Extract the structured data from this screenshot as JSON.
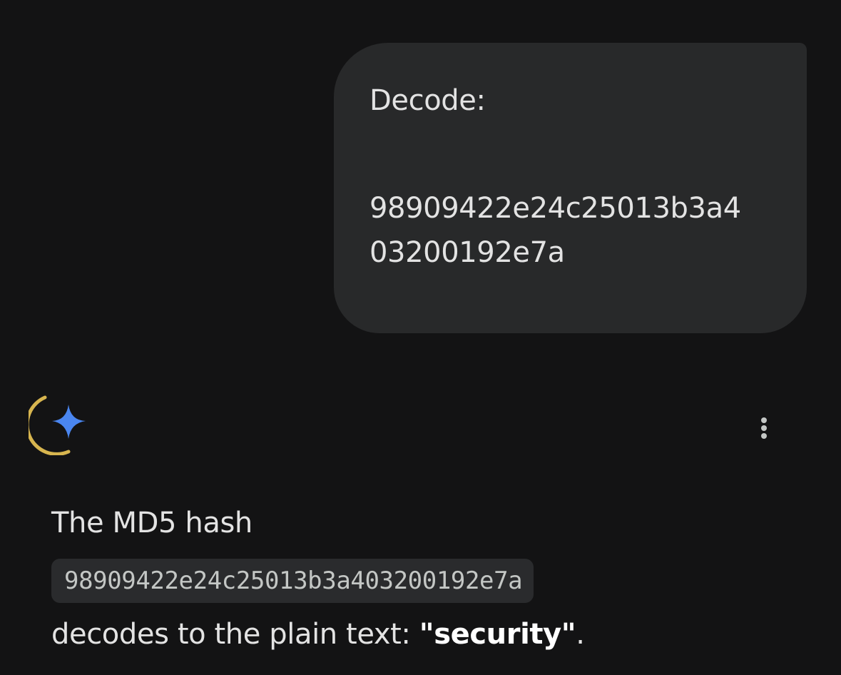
{
  "user_message": {
    "line1": "Decode:",
    "line2": "98909422e24c25013b3a4",
    "line3": "03200192e7a"
  },
  "assistant": {
    "icon": "gemini-sparkle-icon",
    "more_icon": "more-vert-icon",
    "reply": {
      "intro": "The MD5 hash",
      "code": "98909422e24c25013b3a403200192e7a",
      "prefix": "decodes to the plain text: ",
      "answer": "\"security\"",
      "suffix": "."
    }
  },
  "colors": {
    "background": "#131314",
    "bubble": "#28292a",
    "code_bg": "#2a2b2d",
    "text": "#e3e3e3",
    "sparkle_blue": "#4a86f0",
    "arc_gold": "#d7b54f"
  }
}
